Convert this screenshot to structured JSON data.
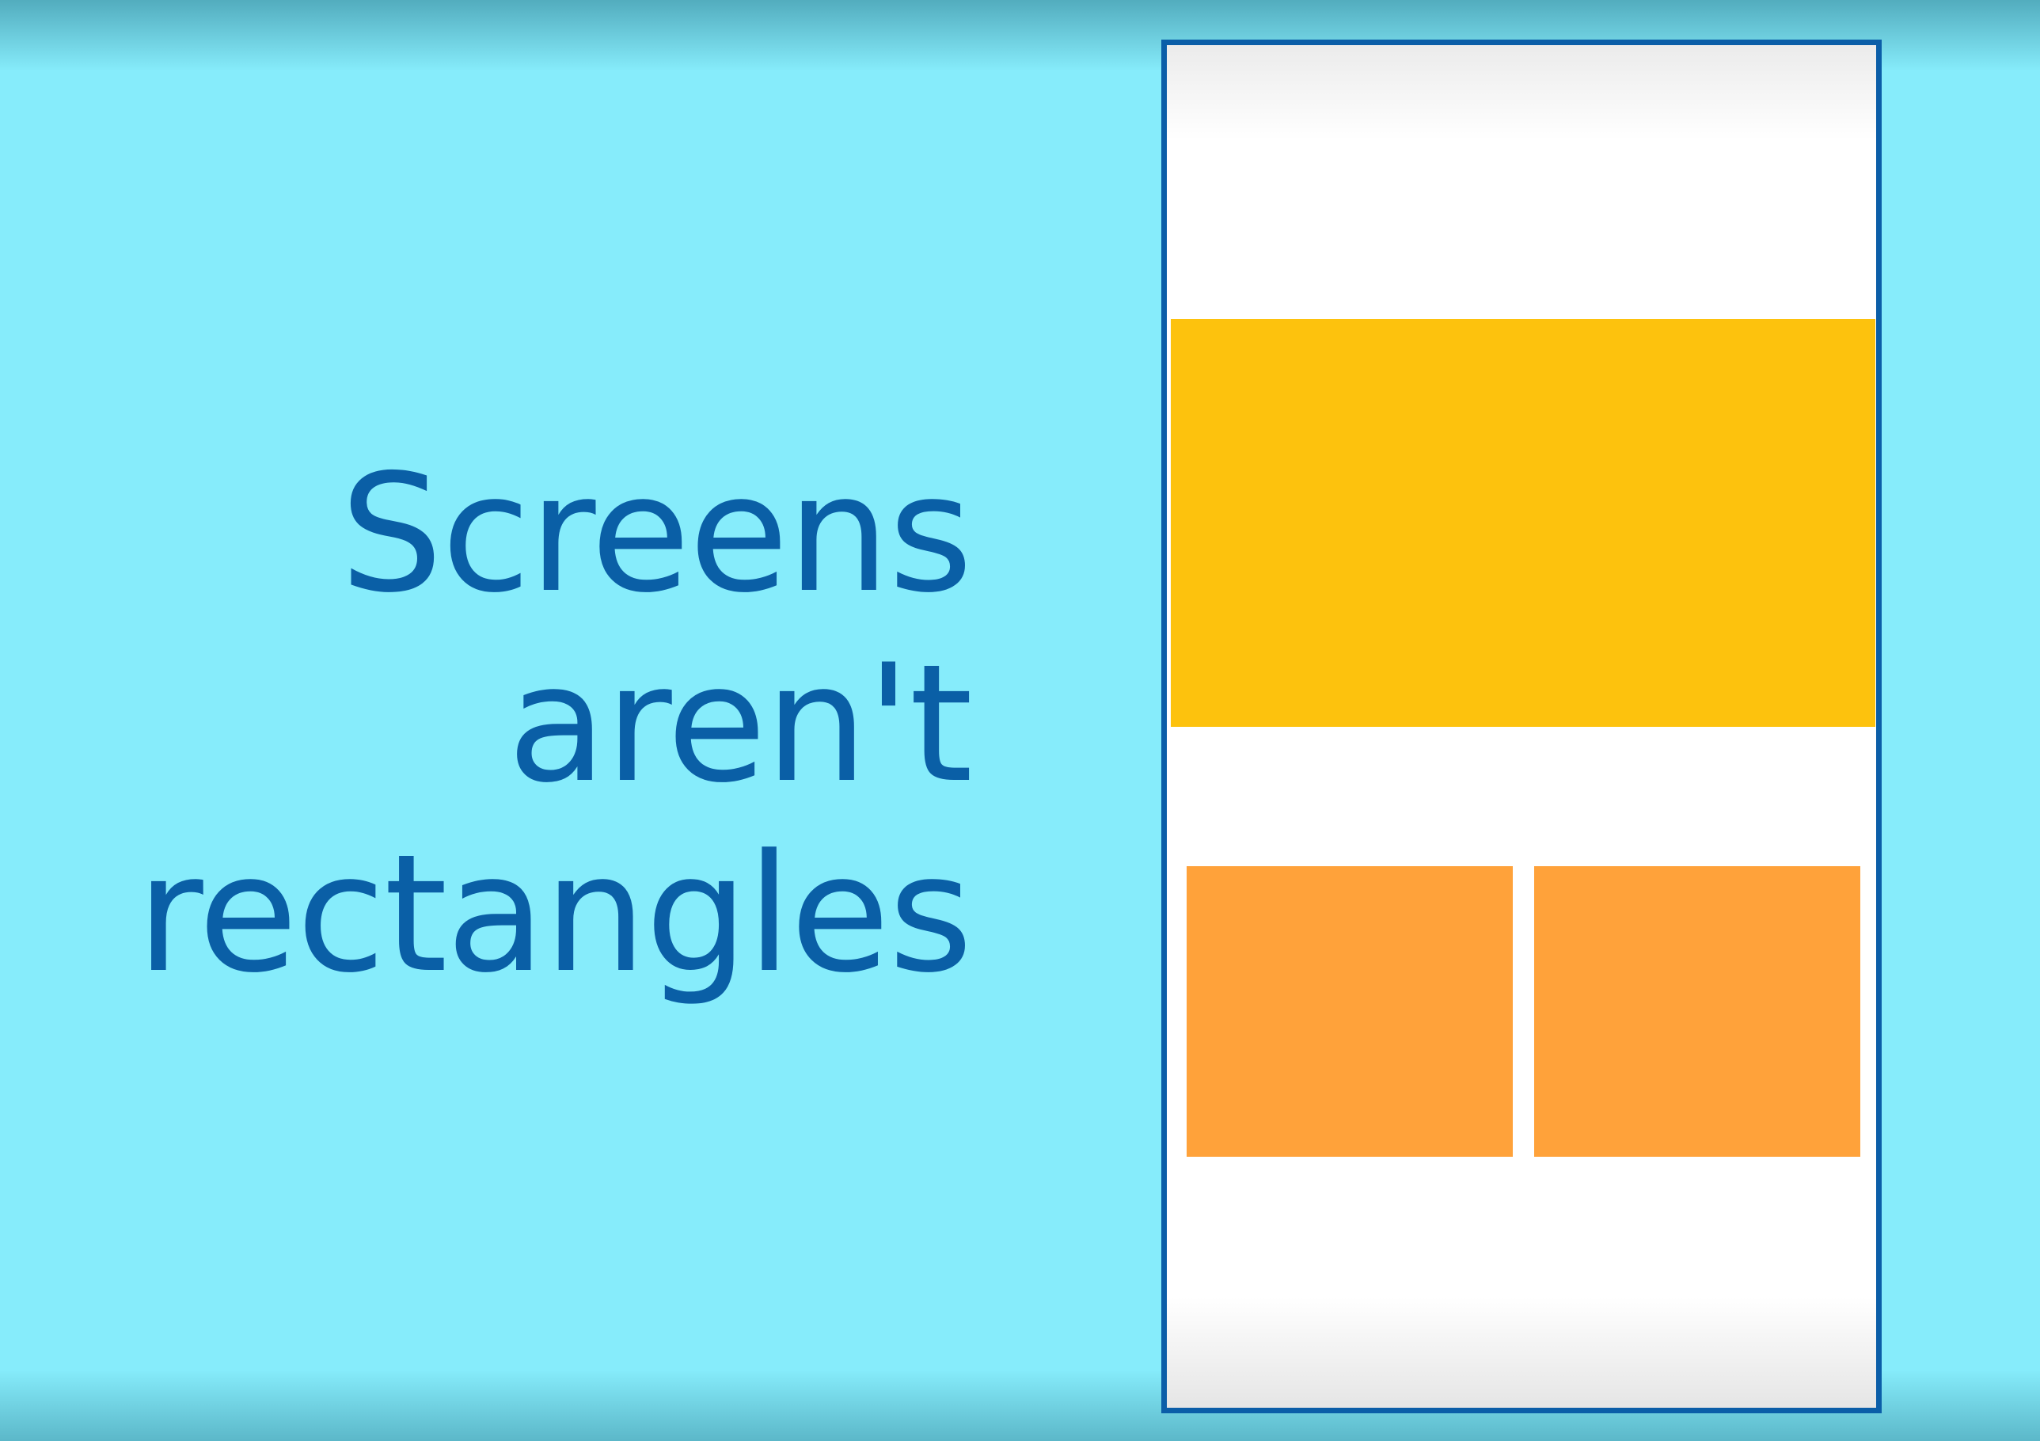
{
  "slide": {
    "headline_lines": [
      "Screens",
      "aren't",
      "rectangles"
    ]
  },
  "colors": {
    "background": "#86ecfb",
    "headline_text": "#0a5fa6",
    "phone_border": "#0b5ea8",
    "phone_screen": "#ffffff",
    "hero_block": "#fdc20d",
    "tiles": "#ffa23a"
  }
}
